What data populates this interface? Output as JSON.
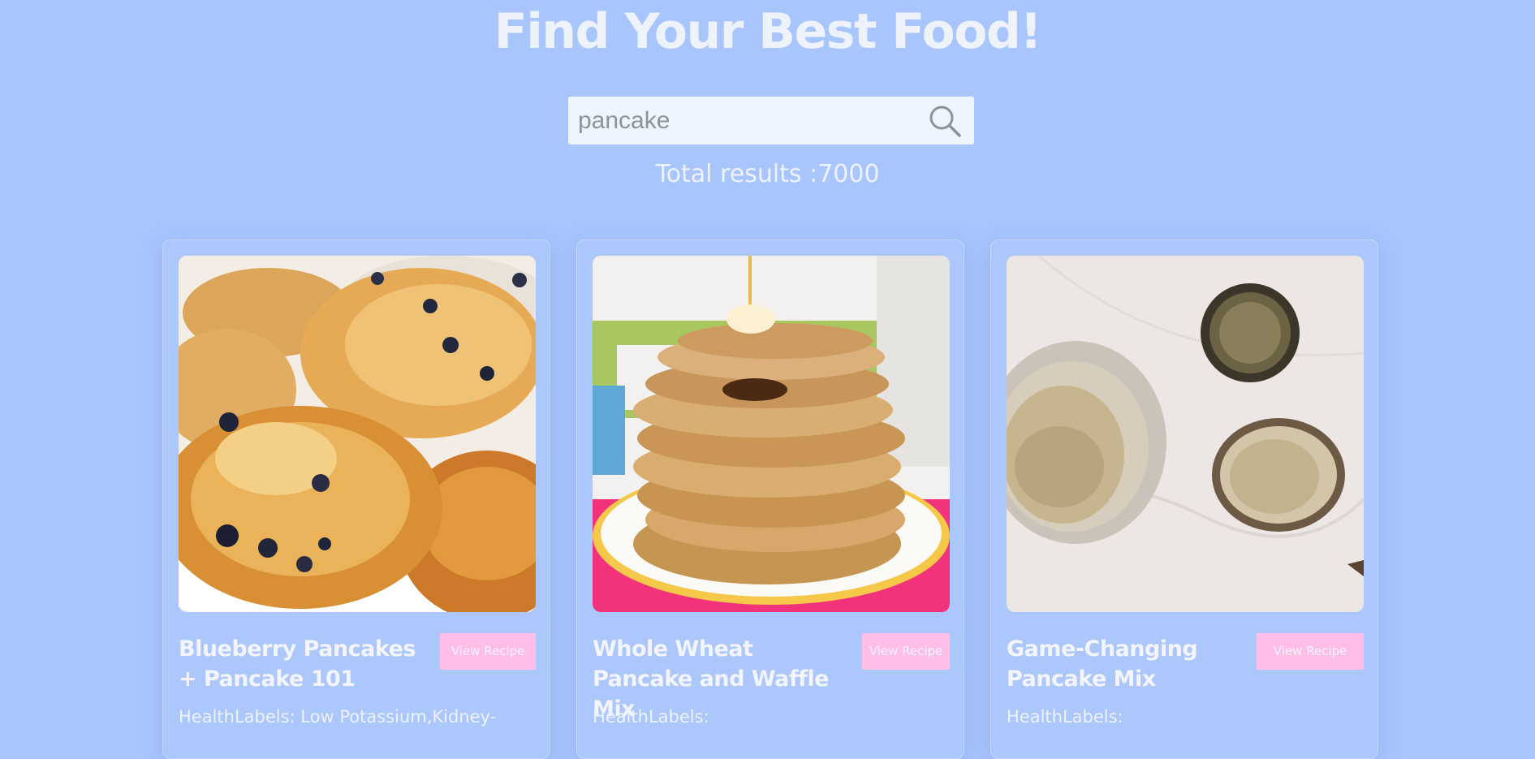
{
  "header": {
    "title": "Find Your Best Food!"
  },
  "search": {
    "value": "pancake",
    "placeholder": ""
  },
  "results": {
    "total_text": "Total results :7000"
  },
  "cards": [
    {
      "title": "Blueberry Pancakes + Pancake 101",
      "button_label": "View Recipe",
      "health_labels": "HealthLabels: Low Potassium,Kidney-"
    },
    {
      "title": "Whole Wheat Pancake and Waffle Mix",
      "button_label": "View Recipe",
      "health_labels": "HealthLabels:"
    },
    {
      "title": "Game-Changing Pancake Mix",
      "button_label": "View Recipe",
      "health_labels": "HealthLabels:"
    }
  ],
  "colors": {
    "background": "#a8c5fd",
    "button": "#ffbee8",
    "text": "#eef2fb",
    "search_background": "#edf5fe"
  },
  "icons": {
    "search": "search-icon"
  }
}
